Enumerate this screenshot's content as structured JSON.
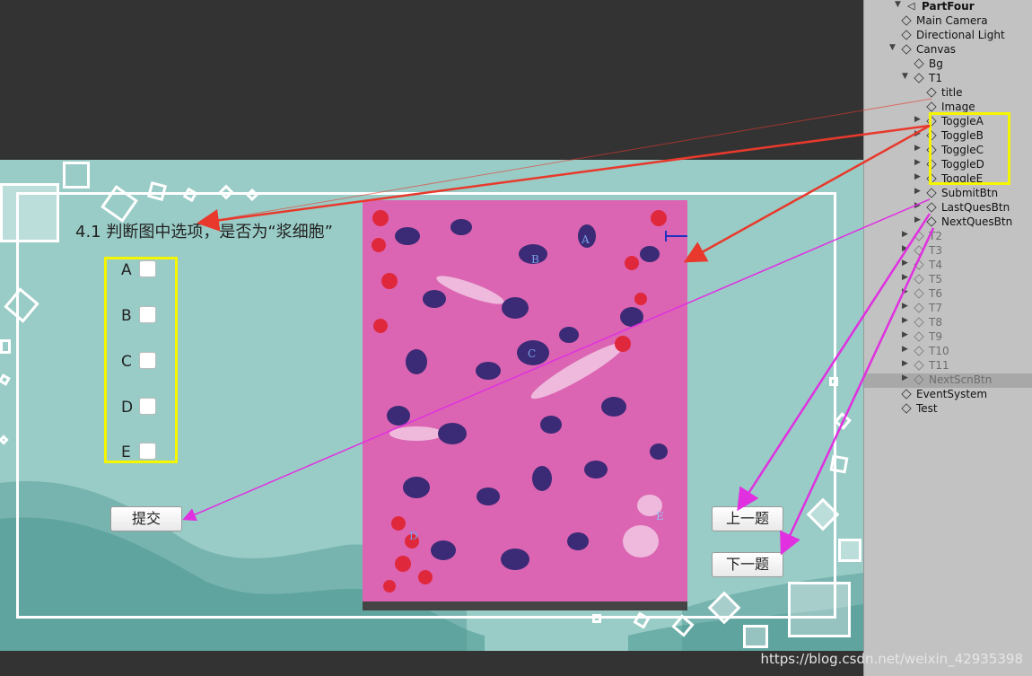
{
  "quiz": {
    "title": "4.1 判断图中选项，是否为“浆细胞”",
    "options": [
      "A",
      "B",
      "C",
      "D",
      "E"
    ],
    "submit_label": "提交",
    "prev_label": "上一题",
    "next_label": "下一题",
    "image_labels": [
      "A",
      "B",
      "C",
      "D",
      "E"
    ]
  },
  "hierarchy": {
    "root": "PartFour",
    "items": [
      {
        "name": "Main Camera"
      },
      {
        "name": "Directional Light"
      },
      {
        "name": "Canvas"
      },
      {
        "name": "Bg"
      },
      {
        "name": "T1"
      },
      {
        "name": "title"
      },
      {
        "name": "Image"
      },
      {
        "name": "ToggleA"
      },
      {
        "name": "ToggleB"
      },
      {
        "name": "ToggleC"
      },
      {
        "name": "ToggleD"
      },
      {
        "name": "ToggleE"
      },
      {
        "name": "SubmitBtn"
      },
      {
        "name": "LastQuesBtn"
      },
      {
        "name": "NextQuesBtn"
      },
      {
        "name": "T2"
      },
      {
        "name": "T3"
      },
      {
        "name": "T4"
      },
      {
        "name": "T5"
      },
      {
        "name": "T6"
      },
      {
        "name": "T7"
      },
      {
        "name": "T8"
      },
      {
        "name": "T9"
      },
      {
        "name": "T10"
      },
      {
        "name": "T11"
      },
      {
        "name": "NextScnBtn"
      },
      {
        "name": "EventSystem"
      },
      {
        "name": "Test"
      }
    ]
  },
  "watermark": "https://blog.csdn.net/weixin_42935398",
  "colors": {
    "game_bg": "#99ccc6",
    "highlight": "#f5f500",
    "arrow_red": "#e8392c",
    "arrow_magenta": "#e030e0"
  }
}
